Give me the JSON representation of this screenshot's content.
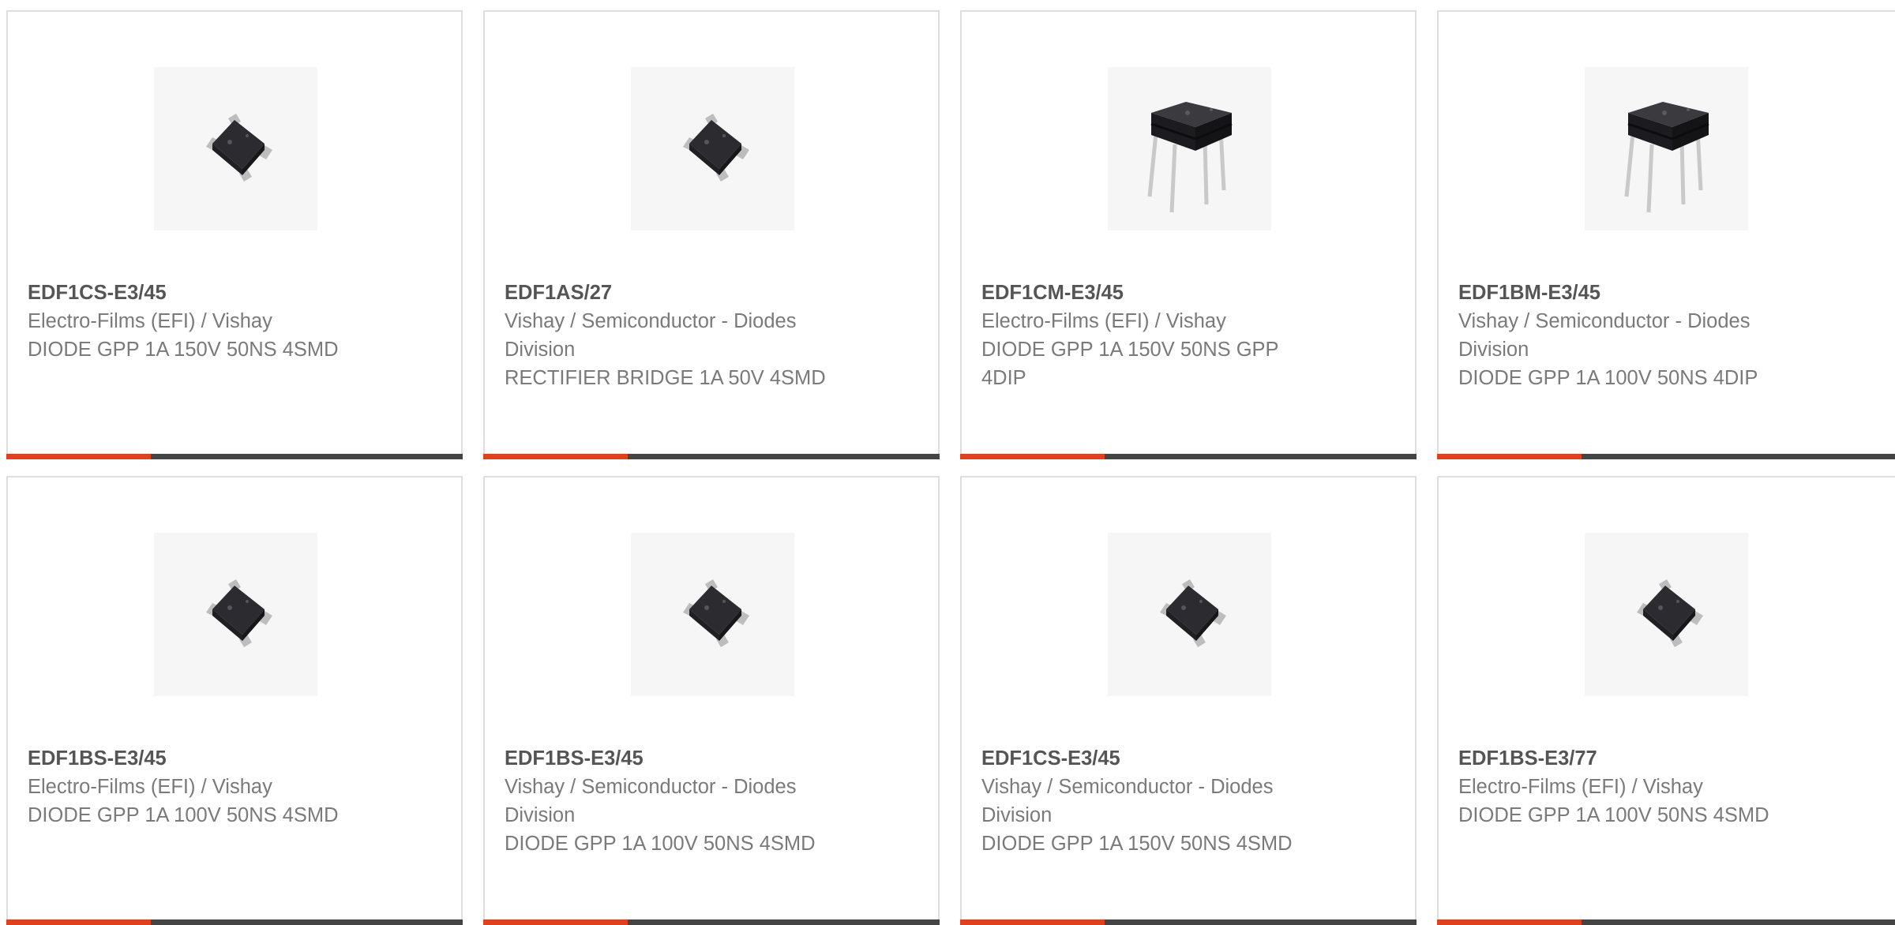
{
  "theme": {
    "accent_color": "#e0401c",
    "bar_color": "#444444",
    "border_color": "#dedede"
  },
  "products": [
    {
      "part_number": "EDF1CS-E3/45",
      "manufacturer": "Electro-Films (EFI) / Vishay",
      "description": "DIODE GPP 1A 150V 50NS 4SMD",
      "image_icon": "smd-bridge-rectifier-icon"
    },
    {
      "part_number": "EDF1AS/27",
      "manufacturer": "Vishay / Semiconductor - Diodes Division",
      "description": "RECTIFIER BRIDGE 1A 50V 4SMD",
      "image_icon": "smd-bridge-rectifier-icon"
    },
    {
      "part_number": "EDF1CM-E3/45",
      "manufacturer": "Electro-Films (EFI) / Vishay",
      "description": "DIODE GPP 1A 150V 50NS GPP 4DIP",
      "image_icon": "dip-bridge-rectifier-icon"
    },
    {
      "part_number": "EDF1BM-E3/45",
      "manufacturer": "Vishay / Semiconductor - Diodes Division",
      "description": "DIODE GPP 1A 100V 50NS 4DIP",
      "image_icon": "dip-bridge-rectifier-icon"
    },
    {
      "part_number": "EDF1BS-E3/45",
      "manufacturer": "Electro-Films (EFI) / Vishay",
      "description": "DIODE GPP 1A 100V 50NS 4SMD",
      "image_icon": "smd-bridge-rectifier-icon"
    },
    {
      "part_number": "EDF1BS-E3/45",
      "manufacturer": "Vishay / Semiconductor - Diodes Division",
      "description": "DIODE GPP 1A 100V 50NS 4SMD",
      "image_icon": "smd-bridge-rectifier-icon"
    },
    {
      "part_number": "EDF1CS-E3/45",
      "manufacturer": "Vishay / Semiconductor - Diodes Division",
      "description": "DIODE GPP 1A 150V 50NS 4SMD",
      "image_icon": "smd-bridge-rectifier-icon"
    },
    {
      "part_number": "EDF1BS-E3/77",
      "manufacturer": "Electro-Films (EFI) / Vishay",
      "description": "DIODE GPP 1A 100V 50NS 4SMD",
      "image_icon": "smd-bridge-rectifier-icon"
    }
  ]
}
